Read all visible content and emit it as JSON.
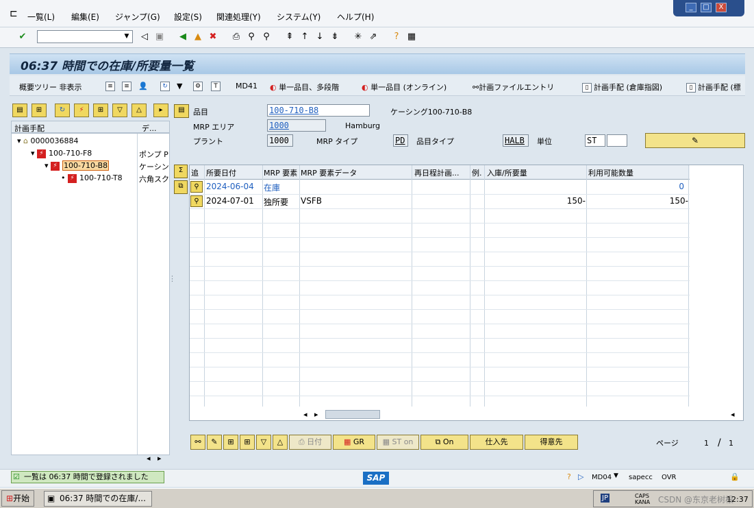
{
  "menu": {
    "items": [
      "一覧(L)",
      "編集(E)",
      "ジャンプ(G)",
      "設定(S)",
      "関連処理(Y)",
      "システム(Y)",
      "ヘルプ(H)"
    ]
  },
  "window_buttons": [
    "_",
    "□",
    "X"
  ],
  "command_field": {
    "value": ""
  },
  "title": "06:37 時間での在庫/所要量一覧",
  "app_toolbar": {
    "tree_toggle": "概要ツリー 非表示",
    "md41": "MD41",
    "single_multi": "単一品目、多段階",
    "single_online": "単一品目 (オンライン)",
    "planning_file": "計画ファイルエントリ",
    "planning_warehouse": "計画手配 (倉庫指図)",
    "planning_std": "計画手配 (標"
  },
  "tree": {
    "header_col1": "計画手配",
    "header_col2": "デ...",
    "rows": [
      {
        "label": "0000036884",
        "desc": ""
      },
      {
        "label": "100-710-F8",
        "desc": "ポンプ P"
      },
      {
        "label": "100-710-B8",
        "desc": "ケーシン"
      },
      {
        "label": "100-710-T8",
        "desc": "六角スク"
      }
    ]
  },
  "header": {
    "material_label": "品目",
    "material_value": "100-710-B8",
    "material_desc": "ケーシング100-710-B8",
    "mrp_area_label": "MRP エリア",
    "mrp_area_value": "1000",
    "mrp_area_desc": "Hamburg",
    "plant_label": "プラント",
    "plant_value": "1000",
    "mrp_type_label": "MRP タイプ",
    "mrp_type_value": "PD",
    "material_type_label": "品目タイプ",
    "material_type_value": "HALB",
    "unit_label": "単位",
    "unit_value": "ST"
  },
  "table": {
    "columns": [
      "追",
      "所要日付",
      "MRP 要素",
      "MRP 要素データ",
      "再日程計画...",
      "例.",
      "入庫/所要量",
      "利用可能数量"
    ],
    "rows": [
      {
        "date": "2024-06-04",
        "element": "在庫",
        "data": "",
        "qty": "",
        "avail": "0"
      },
      {
        "date": "2024-07-01",
        "element": "独所要",
        "data": "VSFB",
        "qty": "150-",
        "avail": "150-"
      }
    ]
  },
  "bottom_buttons": {
    "date": "日付",
    "gr": "GR",
    "st_on": "ST on",
    "on": "On",
    "vendor": "仕入先",
    "customer": "得意先"
  },
  "paging": {
    "label": "ページ",
    "current": "1",
    "sep": "/",
    "total": "1"
  },
  "status": {
    "message": "一覧は 06:37 時間で登録されました",
    "logo": "SAP",
    "transaction": "MD04",
    "server": "sapecc",
    "mode": "OVR"
  },
  "taskbar": {
    "start": "开始",
    "window": "06:37 時間での在庫/...",
    "lang": "JP",
    "ime": "CAPS KANA",
    "watermark": "CSDN @东京老树根",
    "clock": "12:37"
  },
  "colors": {
    "title_bg": "#a8c8e6",
    "button_yellow": "#f3e38a",
    "link_blue": "#1f5fbf"
  }
}
